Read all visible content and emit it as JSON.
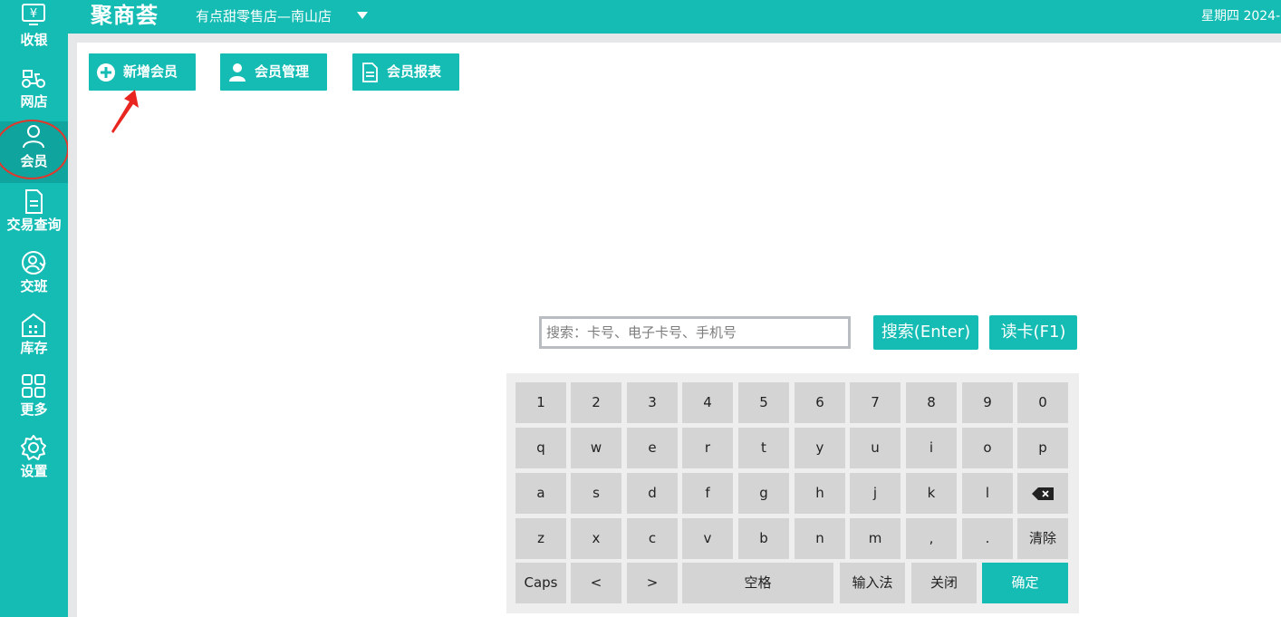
{
  "header": {
    "logo_text": "聚商荟",
    "store_name": "有点甜零售店—南山店",
    "date_text": "星期四 2024-"
  },
  "sidebar": {
    "items": [
      {
        "label": "收银",
        "icon": "cashier-icon"
      },
      {
        "label": "网店",
        "icon": "delivery-scooter-icon"
      },
      {
        "label": "会员",
        "icon": "member-user-icon",
        "active": true
      },
      {
        "label": "交易查询",
        "icon": "document-icon"
      },
      {
        "label": "交班",
        "icon": "shift-handover-icon"
      },
      {
        "label": "库存",
        "icon": "warehouse-icon"
      },
      {
        "label": "更多",
        "icon": "grid-icon"
      },
      {
        "label": "设置",
        "icon": "gear-icon"
      }
    ]
  },
  "toolbar": {
    "add_member": "新增会员",
    "manage_member": "会员管理",
    "member_report": "会员报表"
  },
  "search": {
    "placeholder": "搜索：卡号、电子卡号、手机号",
    "value": "",
    "search_button": "搜索(Enter)",
    "read_card_button": "读卡(F1)"
  },
  "keyboard": {
    "row1": [
      "1",
      "2",
      "3",
      "4",
      "5",
      "6",
      "7",
      "8",
      "9",
      "0"
    ],
    "row2": [
      "q",
      "w",
      "e",
      "r",
      "t",
      "y",
      "u",
      "i",
      "o",
      "p"
    ],
    "row3": [
      "a",
      "s",
      "d",
      "f",
      "g",
      "h",
      "j",
      "k",
      "l"
    ],
    "row4": [
      "z",
      "x",
      "c",
      "v",
      "b",
      "n",
      "m",
      ",",
      "."
    ],
    "clear": "清除",
    "caps": "Caps",
    "lt": "<",
    "gt": ">",
    "space": "空格",
    "ime": "输入法",
    "close": "关闭",
    "confirm": "确定"
  },
  "colors": {
    "brand": "#15bcb4",
    "highlight_ring": "#e2372c",
    "arrow": "#e8251f"
  }
}
